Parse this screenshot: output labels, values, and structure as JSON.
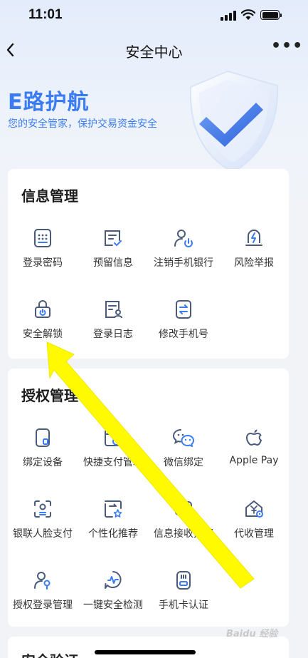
{
  "status_bar": {
    "time": "11:01"
  },
  "nav": {
    "title": "安全中心",
    "more": "•••"
  },
  "hero": {
    "title": "E路护航",
    "subtitle": "您的安全管家，保护交易资金安全"
  },
  "sections": {
    "info": {
      "title": "信息管理",
      "items": [
        {
          "label": "登录密码",
          "icon": "password-keypad-icon"
        },
        {
          "label": "预留信息",
          "icon": "message-check-icon"
        },
        {
          "label": "注销手机银行",
          "icon": "user-power-icon"
        },
        {
          "label": "风险举报",
          "icon": "lightning-alert-icon"
        },
        {
          "label": "安全解锁",
          "icon": "unlock-icon"
        },
        {
          "label": "登录日志",
          "icon": "log-user-icon"
        },
        {
          "label": "修改手机号",
          "icon": "phone-swap-icon"
        }
      ]
    },
    "auth": {
      "title": "授权管理",
      "items": [
        {
          "label": "绑定设备",
          "icon": "device-icon"
        },
        {
          "label": "快捷支付管理",
          "icon": "quick-pay-icon"
        },
        {
          "label": "微信绑定",
          "icon": "wechat-icon"
        },
        {
          "label": "Apple Pay",
          "icon": "apple-icon"
        },
        {
          "label": "银联人脸支付",
          "icon": "face-scan-icon"
        },
        {
          "label": "个性化推荐",
          "icon": "recommend-star-icon"
        },
        {
          "label": "信息接收授权",
          "icon": "info-receive-icon"
        },
        {
          "label": "代收管理",
          "icon": "collection-house-icon"
        },
        {
          "label": "授权登录管理",
          "icon": "auth-login-user-icon"
        },
        {
          "label": "一键安全检测",
          "icon": "security-check-icon"
        },
        {
          "label": "手机卡认证",
          "icon": "sim-card-icon"
        }
      ]
    },
    "verify": {
      "title": "安全验证"
    }
  },
  "watermark": "Baidu 经验",
  "colors": {
    "accent": "#3b7cf3",
    "arrow": "#fffa00",
    "icon": "#4a5a7a"
  }
}
